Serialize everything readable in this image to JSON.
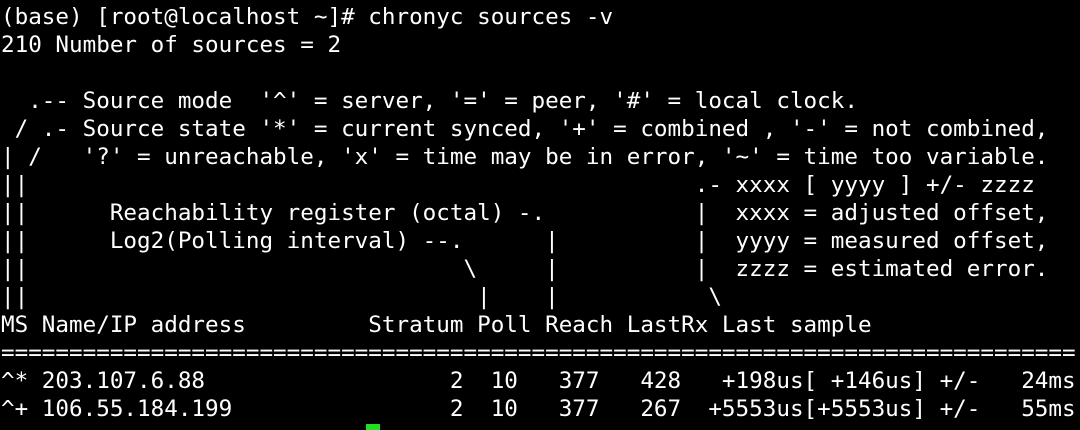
{
  "terminal": {
    "lines": [
      "(base) [root@localhost ~]# chronyc sources -v",
      "210 Number of sources = 2",
      "",
      "  .-- Source mode  '^' = server, '=' = peer, '#' = local clock.",
      " / .- Source state '*' = current synced, '+' = combined , '-' = not combined,",
      "| /   '?' = unreachable, 'x' = time may be in error, '~' = time too variable.",
      "||                                                 .- xxxx [ yyyy ] +/- zzzz",
      "||      Reachability register (octal) -.           |  xxxx = adjusted offset,",
      "||      Log2(Polling interval) --.      |          |  yyyy = measured offset,",
      "||                                \\     |          |  zzzz = estimated error.",
      "||                                 |    |           \\",
      "MS Name/IP address         Stratum Poll Reach LastRx Last sample",
      "===============================================================================",
      "^* 203.107.6.88                  2  10   377   428   +198us[ +146us] +/-   24ms",
      "^+ 106.55.184.199                2  10   377   267  +5553us[+5553us] +/-   55ms"
    ]
  },
  "colors": {
    "background": "#000000",
    "foreground": "#ffffff",
    "cursor": "#22dd22"
  }
}
